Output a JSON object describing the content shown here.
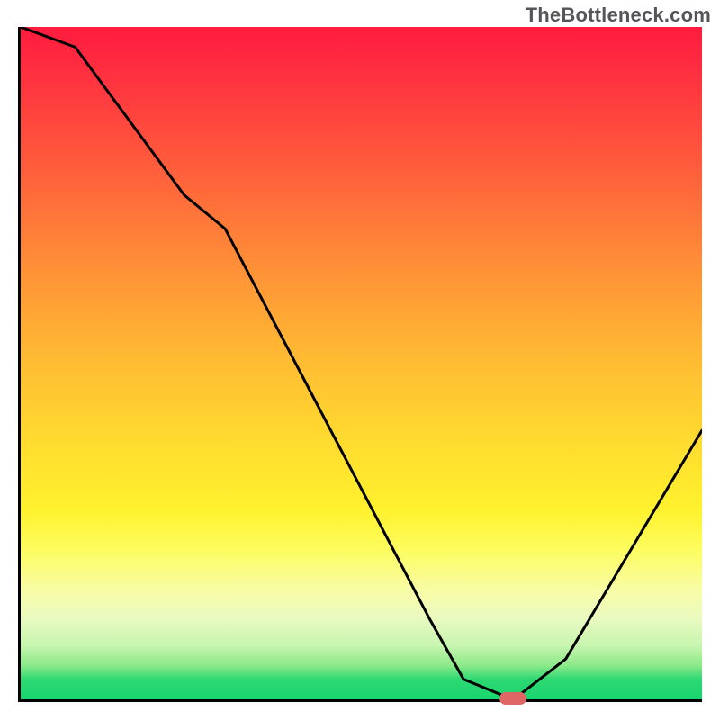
{
  "watermark": "TheBottleneck.com",
  "chart_data": {
    "type": "line",
    "title": "",
    "xlabel": "",
    "ylabel": "",
    "xlim": [
      0,
      100
    ],
    "ylim": [
      0,
      100
    ],
    "x": [
      0,
      8,
      24,
      30,
      60,
      65,
      71,
      73,
      80,
      100
    ],
    "values": [
      100,
      97,
      75,
      70,
      12,
      3,
      0.5,
      0.5,
      6,
      40
    ],
    "marker": {
      "x": 72,
      "y": 0.5
    },
    "background_gradient": {
      "top": "#ff1b3e",
      "mid": "#ffdc2f",
      "bottom": "#19d56e"
    },
    "grid": false,
    "legend": false
  }
}
